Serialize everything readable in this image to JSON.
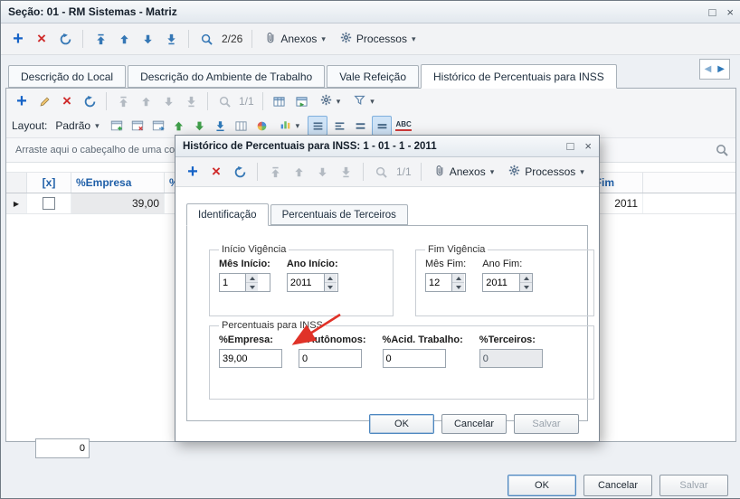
{
  "icons": {
    "add": "+",
    "delete": "×",
    "chevron": "▾",
    "prev": "◀",
    "next": "▶",
    "row_indicator": "▶"
  },
  "window": {
    "title": "Seção: 01 - RM Sistemas - Matriz",
    "maximize": "□",
    "close": "×"
  },
  "main_toolbar": {
    "record_counter": "2/26",
    "anexos": "Anexos",
    "processos": "Processos"
  },
  "tabs": [
    {
      "label": "Descrição do Local"
    },
    {
      "label": "Descrição do Ambiente de Trabalho"
    },
    {
      "label": "Vale Refeição"
    },
    {
      "label": "Histórico de Percentuais para INSS"
    }
  ],
  "grid_toolbar": {
    "record_counter": "1/1",
    "layout_label": "Layout:",
    "layout_value": "Padrão",
    "abc": "ABC"
  },
  "group_bar": {
    "text": "Arraste aqui o cabeçalho de uma col"
  },
  "grid": {
    "header": {
      "check": "[x]",
      "empresa": "%Empresa",
      "terceiros": "%Ter",
      "ano_fim": "o Fim"
    },
    "row": {
      "empresa": "39,00",
      "ano_fim": "2011"
    }
  },
  "footer": {
    "counter": "0",
    "ok": "OK",
    "cancel": "Cancelar",
    "save": "Salvar"
  },
  "dialog": {
    "title": "Histórico de Percentuais para INSS: 1 - 01 - 1 - 2011",
    "maximize": "□",
    "close": "×",
    "toolbar": {
      "record_counter": "1/1",
      "anexos": "Anexos",
      "processos": "Processos"
    },
    "tabs": [
      {
        "label": "Identificação"
      },
      {
        "label": "Percentuais de Terceiros"
      }
    ],
    "inicio_vigencia": {
      "title": "Início Vigência",
      "mes_label": "Mês Início:",
      "mes_value": "1",
      "ano_label": "Ano Início:",
      "ano_value": "2011"
    },
    "fim_vigencia": {
      "title": "Fim Vigência",
      "mes_label": "Mês Fim:",
      "mes_value": "12",
      "ano_label": "Ano Fim:",
      "ano_value": "2011"
    },
    "percentuais": {
      "title": "Percentuais para INSS",
      "fields": [
        {
          "label": "%Empresa:",
          "value": "39,00"
        },
        {
          "label": "%Autônomos:",
          "value": "0"
        },
        {
          "label": "%Acid. Trabalho:",
          "value": "0"
        },
        {
          "label": "%Terceiros:",
          "value": "0"
        }
      ]
    },
    "buttons": {
      "ok": "OK",
      "cancel": "Cancelar",
      "save": "Salvar"
    }
  }
}
